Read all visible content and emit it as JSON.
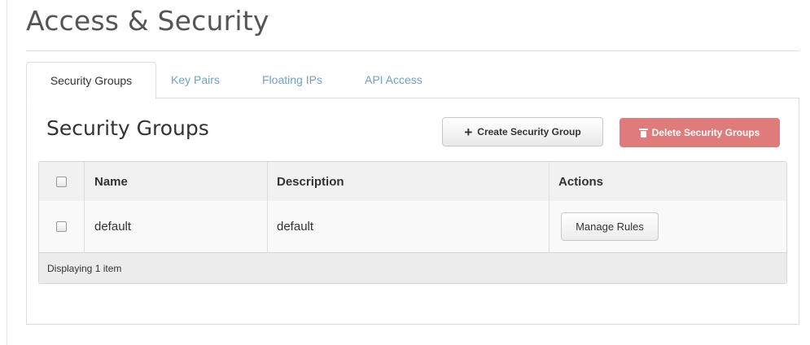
{
  "page": {
    "title": "Access & Security"
  },
  "tabs": [
    {
      "label": "Security Groups",
      "active": true
    },
    {
      "label": "Key Pairs",
      "active": false
    },
    {
      "label": "Floating IPs",
      "active": false
    },
    {
      "label": "API Access",
      "active": false
    }
  ],
  "section": {
    "title": "Security Groups",
    "create_button": "Create Security Group",
    "delete_button": "Delete Security Groups"
  },
  "table": {
    "columns": [
      "Name",
      "Description",
      "Actions"
    ],
    "rows": [
      {
        "name": "default",
        "description": "default",
        "action": "Manage Rules"
      }
    ],
    "footer": "Displaying 1 item"
  },
  "colors": {
    "link": "#6fa3c5",
    "danger": "#e07b7b",
    "title": "#555555"
  },
  "icons": {
    "create": "plus-icon",
    "delete": "trash-icon"
  }
}
